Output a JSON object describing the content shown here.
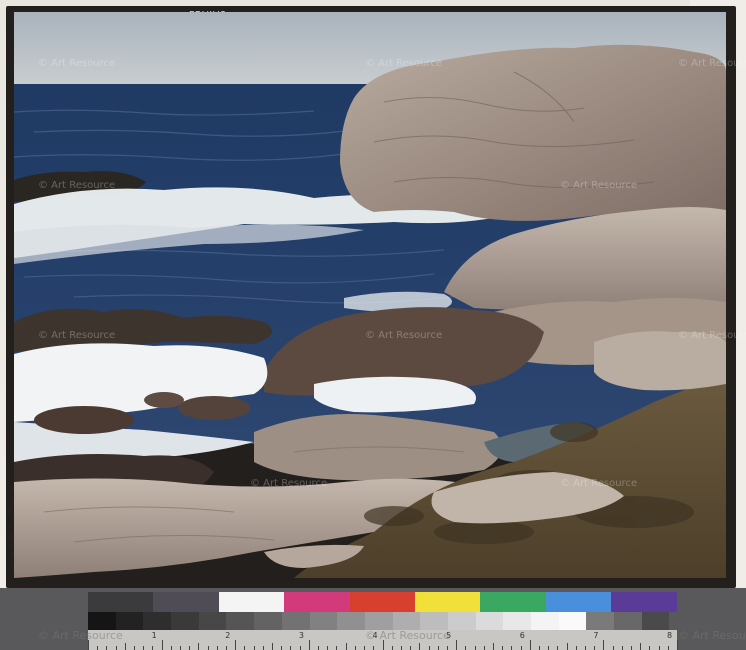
{
  "edge_code": "LBAIA8",
  "watermark_text": "© Art Resource",
  "calibration": {
    "color_patches": [
      "#3b3b3d",
      "#4f4c55",
      "#f4f4f4",
      "#d23a7b",
      "#d7402e",
      "#f2e03a",
      "#3aa860",
      "#4a8fdb",
      "#5b3b98"
    ],
    "gray_patches": [
      "#151515",
      "#222222",
      "#2e2e2e",
      "#3a3a3a",
      "#474747",
      "#555555",
      "#636363",
      "#727272",
      "#818181",
      "#909090",
      "#9f9f9f",
      "#aeaeae",
      "#bdbdbd",
      "#cccccc",
      "#dbdbdb",
      "#e8e8e8",
      "#f4f4f4",
      "#fafafa",
      "#7a7a7a",
      "#686868",
      "#4a4a4a"
    ],
    "ruler_numbers": [
      "1",
      "2",
      "3",
      "4",
      "5",
      "6",
      "7",
      "8"
    ]
  }
}
